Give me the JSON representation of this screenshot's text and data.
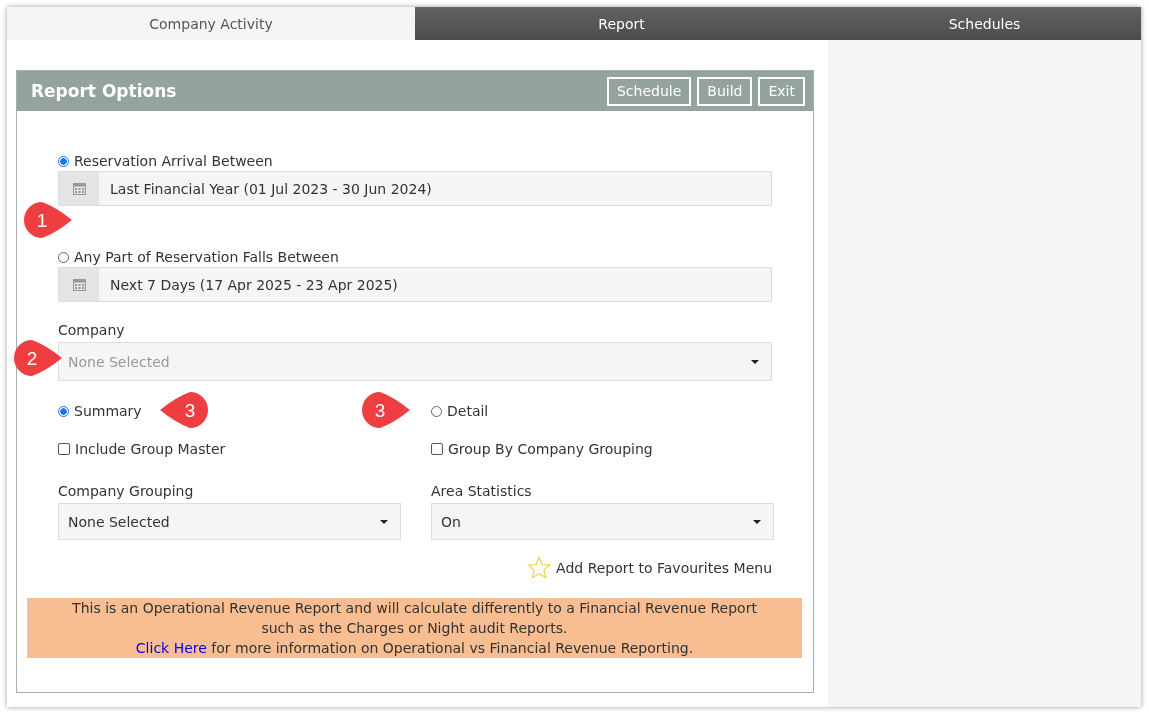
{
  "tabs": [
    {
      "label": "Company Activity",
      "selected": true
    },
    {
      "label": "Report",
      "selected": false
    },
    {
      "label": "Schedules",
      "selected": false
    }
  ],
  "panel": {
    "title": "Report Options",
    "buttons": [
      "Schedule",
      "Build",
      "Exit"
    ]
  },
  "date_filters": [
    {
      "label": "Reservation Arrival Between",
      "selected": true,
      "value": "Last Financial Year (01 Jul 2023 - 30 Jun 2024)"
    },
    {
      "label": "Any Part of Reservation Falls Between",
      "selected": false,
      "value": "Next 7 Days (17 Apr 2025 - 23 Apr 2025)"
    }
  ],
  "company": {
    "label": "Company",
    "placeholder": "None Selected"
  },
  "report_type": [
    {
      "label": "Summary",
      "selected": true
    },
    {
      "label": "Detail",
      "selected": false
    }
  ],
  "options": [
    {
      "label": "Include Group Master",
      "checked": false
    },
    {
      "label": "Group By Company Grouping",
      "checked": false
    }
  ],
  "selects": [
    {
      "label": "Company Grouping",
      "value": "None Selected"
    },
    {
      "label": "Area Statistics",
      "value": "On"
    }
  ],
  "favourite": {
    "label": "Add Report to Favourites Menu"
  },
  "notice": {
    "lines": [
      "This is an Operational Revenue Report and will calculate differently to a Financial Revenue Report",
      "such as the Charges or Night audit Reports."
    ],
    "link": "Click Here",
    "after_link": "for more information on Operational vs Financial Revenue Reporting."
  },
  "callouts": [
    {
      "number": "1",
      "kind": "right"
    },
    {
      "number": "2",
      "kind": "right"
    },
    {
      "number": "3",
      "kind": "left"
    },
    {
      "number": "3",
      "kind": "right"
    }
  ]
}
